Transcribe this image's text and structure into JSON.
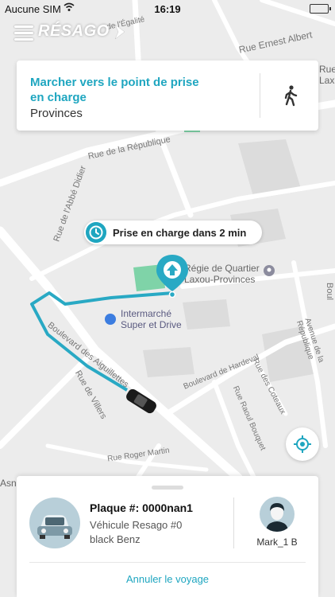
{
  "status_bar": {
    "carrier": "Aucune SIM",
    "time": "16:19"
  },
  "app": {
    "logo": "RÉSAGO"
  },
  "instruction_card": {
    "title": "Marcher vers le point de prise en charge",
    "subtitle": "Provinces",
    "icon": "walking-person-icon"
  },
  "eta": {
    "text": "Prise en charge dans 2 min",
    "icon": "clock-icon"
  },
  "map_labels": {
    "street_1": "Rue Ernest Albert",
    "street_2": "Rue de la République",
    "street_3": "Rue de l'Abbé Didier",
    "street_4": "Boulevard des Aiguillettes",
    "street_5": "Rue de Villers",
    "street_6": "Boulevard de Hardeval",
    "street_7": "Rue des Coteaux",
    "street_8": "Rue Raoul Bouquet",
    "street_9": "Rue Roger Martin",
    "street_10": "Avenue de la République",
    "poi_1": "Régie de Quartier\nLaxou-Provinces",
    "poi_2": "Intermarché\nSuper et Drive",
    "corner_1": "Rue\nLax",
    "corner_2": "Asn",
    "corner_3": "Boul",
    "corner_4": "de l'Égalité"
  },
  "booking_panel": {
    "plate": "Plaque #: 0000nan1",
    "vehicle": "Véhicule Resago #0",
    "color": "black Benz",
    "driver_name": "Mark_1 B",
    "cancel_label": "Annuler le voyage"
  },
  "colors": {
    "accent": "#1fa6c0",
    "route": "#29a9c4",
    "park": "#7fd3a8"
  }
}
